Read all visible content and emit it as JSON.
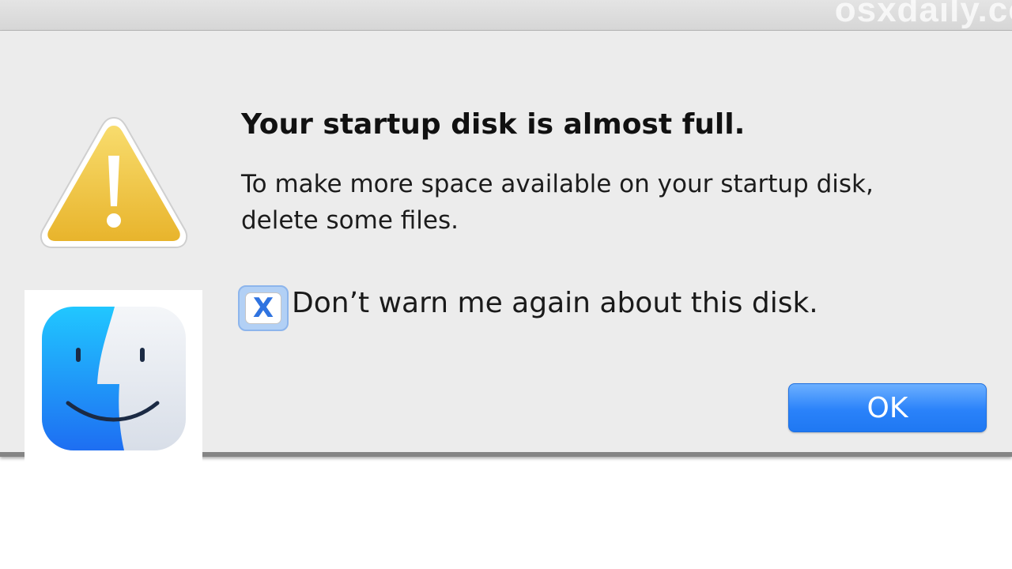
{
  "watermark": "osxdaily.com",
  "alert": {
    "title": "Your startup disk is almost full.",
    "message_line1": "To make more space available on your startup disk,",
    "message_line2": "delete some files.",
    "checkbox": {
      "label": "Don’t warn me again about this disk.",
      "checked": true,
      "mark": "X"
    },
    "ok_label": "OK"
  },
  "icons": {
    "alert_icon": "warning-icon",
    "app_icon": "finder-icon"
  },
  "colors": {
    "accent": "#2a82fa",
    "warning_yellow": "#f2c53d",
    "finder_blue": "#1f8cf5"
  }
}
